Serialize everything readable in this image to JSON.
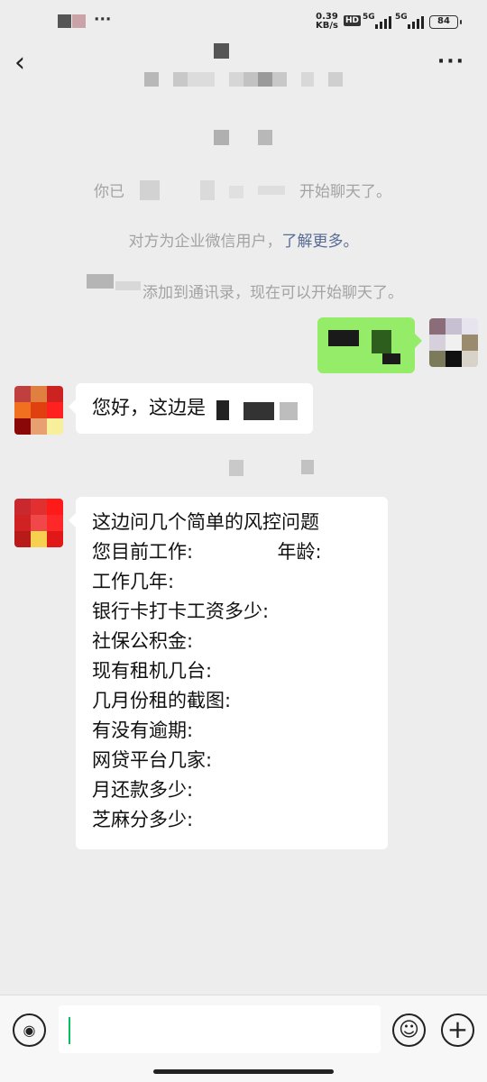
{
  "status_bar": {
    "more": "···",
    "speed_value": "0.39",
    "speed_unit": "KB/s",
    "hd": "HD",
    "signal1": "5G",
    "signal2": "5G",
    "battery": "84"
  },
  "nav": {
    "back_icon": "chevron-left-icon",
    "more_icon": "more-horizontal-icon",
    "more_label": "···"
  },
  "system_messages": {
    "msg1_start": "你已",
    "msg1_end": "开始聊天了。",
    "msg2_text": "对方为企业微信用户，",
    "msg2_link": "了解更多。",
    "msg3_text": "添加到通讯录，现在可以开始聊天了。"
  },
  "incoming_greeting": "您好，这边是",
  "questions": [
    "这边问几个简单的风控问题",
    "您目前工作:              年龄:",
    "工作几年:",
    "银行卡打卡工资多少:",
    "社保公积金:",
    "现有租机几台:",
    "几月份租的截图:",
    "有没有逾期:",
    "网贷平台几家:",
    "月还款多少:",
    "芝麻分多少:"
  ],
  "input_bar": {
    "voice_icon": "voice-icon",
    "voice_glyph": "◉",
    "emoji_icon": "emoji-icon",
    "emoji_glyph": "☺",
    "plus_icon": "plus-icon",
    "plus_glyph": "+"
  },
  "colors": {
    "outgoing_bubble": "#95ec69",
    "link": "#576b95",
    "caret": "#07c160"
  }
}
